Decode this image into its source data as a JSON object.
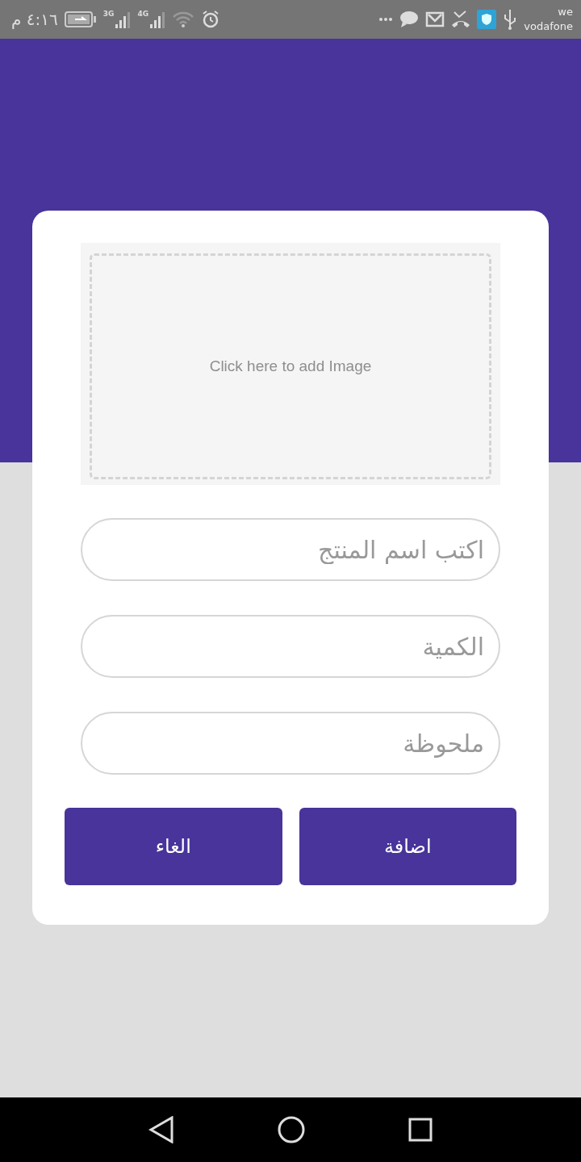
{
  "status_bar": {
    "time": "٤:١٦ م",
    "network_labels": [
      "4G",
      "3G"
    ],
    "carriers": [
      "we",
      "vodafone"
    ]
  },
  "image_picker": {
    "label": "Click here to add Image"
  },
  "fields": [
    {
      "placeholder": "اكتب اسم المنتج"
    },
    {
      "placeholder": "الكمية"
    },
    {
      "placeholder": "ملحوظة"
    }
  ],
  "buttons": [
    "اضافة",
    "الغاء"
  ]
}
